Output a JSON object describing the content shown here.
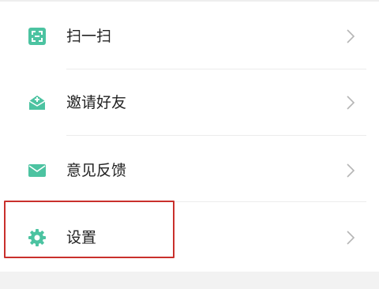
{
  "menu": {
    "items": [
      {
        "label": "扫一扫",
        "icon": "scan-icon"
      },
      {
        "label": "邀请好友",
        "icon": "invite-friend-icon"
      },
      {
        "label": "意见反馈",
        "icon": "feedback-mail-icon"
      },
      {
        "label": "设置",
        "icon": "settings-gear-icon"
      }
    ]
  },
  "colors": {
    "icon_green": "#4cc3a1",
    "highlight_red": "#c9302c",
    "chevron_gray": "#b5b5b5"
  }
}
